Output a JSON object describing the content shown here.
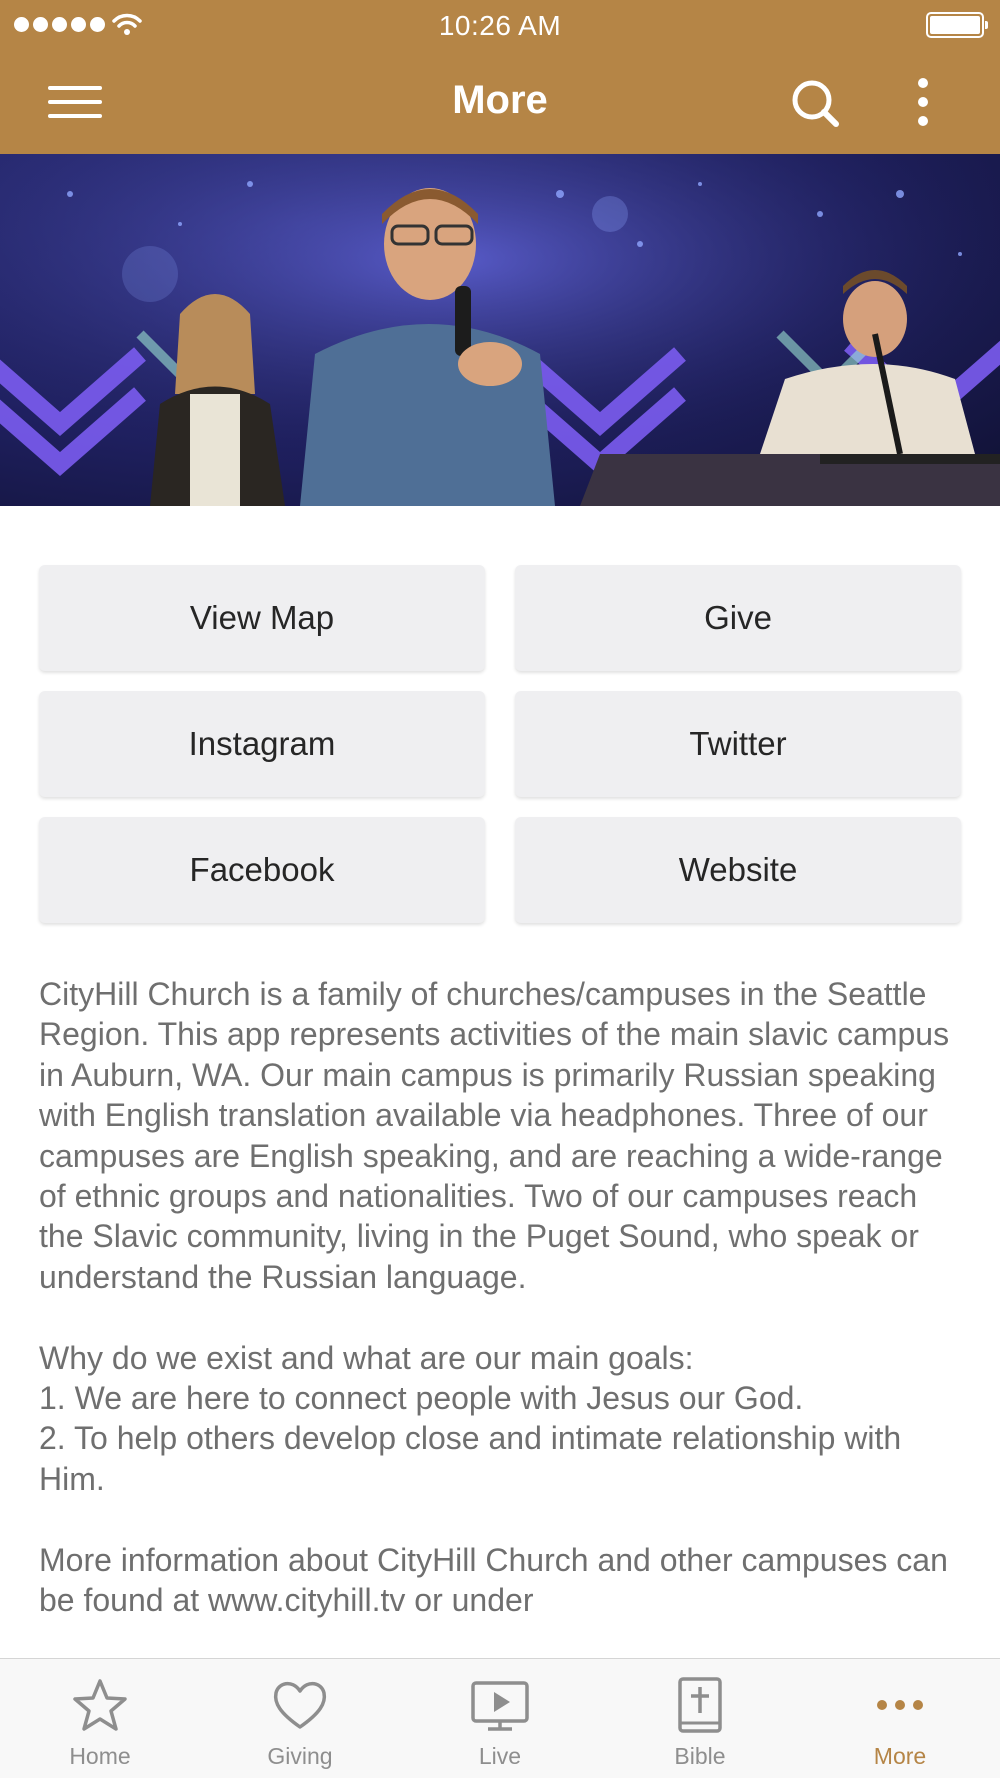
{
  "status_bar": {
    "time": "10:26 AM"
  },
  "nav": {
    "title": "More"
  },
  "buttons": {
    "view_map": "View Map",
    "give": "Give",
    "instagram": "Instagram",
    "twitter": "Twitter",
    "facebook": "Facebook",
    "website": "Website"
  },
  "description": "CityHill Church is a family of churches/campuses in the Seattle Region. This app represents activities of the main slavic campus in Auburn, WA. Our main campus is primarily Russian speaking with English translation available via headphones. Three of our campuses are English speaking, and are reaching a wide-range of ethnic groups and nationalities. Two of our campuses reach the Slavic community, living in the Puget Sound, who speak or understand the Russian language.\n\nWhy do we exist and what are our main goals:\n1. We are here to connect people with Jesus our God.\n2. To help others develop close and intimate relationship with Him.\n\nMore information about CityHill Church and other campuses can be found at www.cityhill.tv or under",
  "tabs": [
    {
      "label": "Home",
      "icon": "star-icon"
    },
    {
      "label": "Giving",
      "icon": "heart-icon"
    },
    {
      "label": "Live",
      "icon": "tv-play-icon"
    },
    {
      "label": "Bible",
      "icon": "bible-icon"
    },
    {
      "label": "More",
      "icon": "more-dots-icon",
      "active": true
    }
  ],
  "colors": {
    "brand": "#b58546",
    "button_bg": "#efeff1",
    "text_muted": "#6f6f6f",
    "tab_inactive": "#8e8e8e"
  }
}
